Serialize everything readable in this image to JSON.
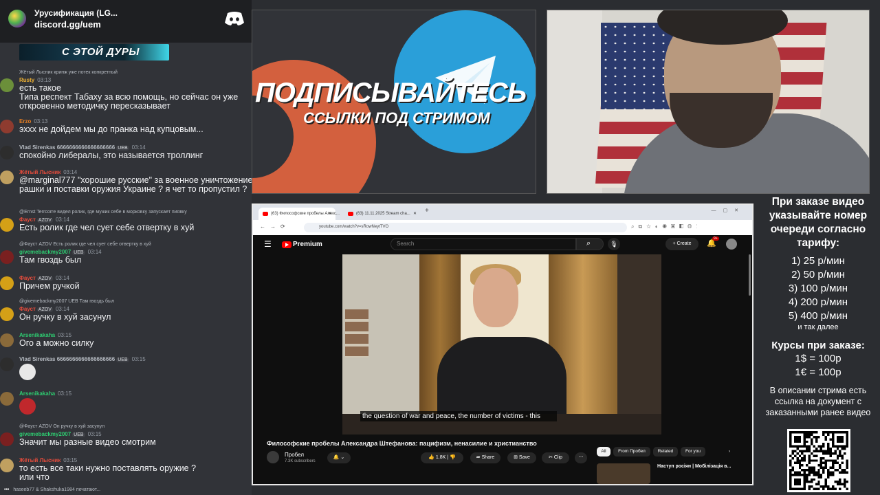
{
  "discord": {
    "server_name": "Урусификация (LG...",
    "invite": "discord.gg/uem",
    "banner_text": "С ЭТОЙ ДУРЫ",
    "messages": [
      {
        "reply": "Жётый Лысник кринж уже потек конкретный",
        "name": "Rusty",
        "name_color": "#f0b232",
        "badges": "",
        "time": "03:13",
        "text": "есть такое\nТипа респект Табаху за всю помощь, но сейчас он уже откровенно методичку пересказывает",
        "avatar": "#6b8f3a"
      },
      {
        "reply": "",
        "name": "Erzo",
        "name_color": "#e67e22",
        "badges": "",
        "time": "03:13",
        "text": "эххх не дойдем мы до пранка над купцовым...",
        "avatar": "#8e3b2f"
      },
      {
        "reply": "",
        "name": "Vlad Sirenkas 6666666666666666666",
        "name_color": "#b5bac1",
        "badges": "UEB",
        "time": "03:14",
        "text": "спокойно либералы, это называется троллинг",
        "avatar": "#2d2d2d"
      },
      {
        "reply": "",
        "name": "Жётый Лысник",
        "name_color": "#e74c3c",
        "badges": "",
        "time": "03:14",
        "text": "@marginal777 \"хорошие русские\" за военное уничтожение рашки и поставки оружия Украине ? я чет то пропустил ?",
        "avatar": "#c0a060"
      },
      {
        "reply": "@Ernst Terrcorre видел ролик, где мужик себе в морковку запускает пиявку",
        "name": "Фауст",
        "name_color": "#e74c3c",
        "badges": "AZOV",
        "time": "03:14",
        "text": "Есть ролик где чел сует себе отвертку в хуй",
        "avatar": "#d4a017"
      },
      {
        "reply": "@Фауст AZOV Есть ролик где чел сует себе отвертку в хуй",
        "name": "givemebackmy2007",
        "name_color": "#2ecc71",
        "badges": "UEB",
        "time": "03:14",
        "text": "Там гвоздь был",
        "avatar": "#7a2020"
      },
      {
        "reply": "",
        "name": "Фауст",
        "name_color": "#e74c3c",
        "badges": "AZOV",
        "time": "03:14",
        "text": "Причем ручкой",
        "avatar": "#d4a017"
      },
      {
        "reply": "@givemebackmy2007 UEB Там гвоздь был",
        "name": "Фауст",
        "name_color": "#e74c3c",
        "badges": "AZOV",
        "time": "03:14",
        "text": "Он ручку в хуй засунул",
        "avatar": "#d4a017"
      },
      {
        "reply": "",
        "name": "Arsenikakaha",
        "name_color": "#2ecc71",
        "badges": "",
        "time": "03:15",
        "text": "Ого а можно силку",
        "avatar": "#8a6a3a"
      },
      {
        "reply": "",
        "name": "Vlad Sirenkas 6666666666666666666",
        "name_color": "#b5bac1",
        "badges": "UEB",
        "time": "03:15",
        "text": "",
        "avatar": "#2d2d2d"
      },
      {
        "reply": "",
        "name": "Arsenikakaha",
        "name_color": "#2ecc71",
        "badges": "",
        "time": "03:15",
        "text": "",
        "avatar": "#8a6a3a"
      },
      {
        "reply": "@Фауст AZOV Он ручку в хуй засунул",
        "name": "givemebackmy2007",
        "name_color": "#2ecc71",
        "badges": "UEB",
        "time": "03:15",
        "text": "Значит мы разные видео смотрим",
        "avatar": "#7a2020"
      },
      {
        "reply": "",
        "name": "Жётый Лысник",
        "name_color": "#e74c3c",
        "badges": "",
        "time": "03:15",
        "text": "то есть все таки нужно поставлять оружие ?\nили что",
        "avatar": "#c0a060"
      }
    ],
    "typing": "haseeb77 & Shakshuka1984 печатают..."
  },
  "promo": {
    "title": "ПОДПИСЫВАЙТЕСЬ",
    "subtitle": "ССЫЛКИ ПОД СТРИМОМ"
  },
  "browser": {
    "tab1": "(63) Философские пробелы Алекс...",
    "tab2": "(63) 11.11.2025 Stream cha...",
    "url": "youtube.com/watch?v=sRowNeytTVO",
    "yt": {
      "premium": "Premium",
      "search_placeholder": "Search",
      "create": "Create",
      "notif_count": "9+",
      "subtitle": "the question of war and peace, the number of victims - this",
      "video_title": "Философские пробелы Александра Штефанова: пацифизм, ненасилие и христианство",
      "channel": "Пробел",
      "subs": "7.3K subscribers",
      "likes": "1.8K",
      "share": "Share",
      "save": "Save",
      "clip": "Clip",
      "chips": [
        "All",
        "From Пробел",
        "Related",
        "For you"
      ],
      "related_title": "Наступ росіян | Мобілізація в..."
    }
  },
  "info": {
    "order_title": "При заказе видео указывайте номер очереди согласно тарифу:",
    "rates": [
      "1) 25 р/мин",
      "2) 50 р/мин",
      "3) 100 р/мин",
      "4) 200 р/мин",
      "5) 400 р/мин"
    ],
    "rates_more": "и так далее",
    "fx_title": "Курсы при заказе:",
    "fx": [
      "1$ = 100р",
      "1€ = 100р"
    ],
    "doc_note": "В описании стрима есть ссылка на документ с заказанными ранее видео"
  },
  "colors": {
    "discord_bg": "#313338",
    "accent_red": "#ff0000",
    "telegram_blue": "#2a9fd9",
    "patreon_orange": "#d3603e"
  }
}
